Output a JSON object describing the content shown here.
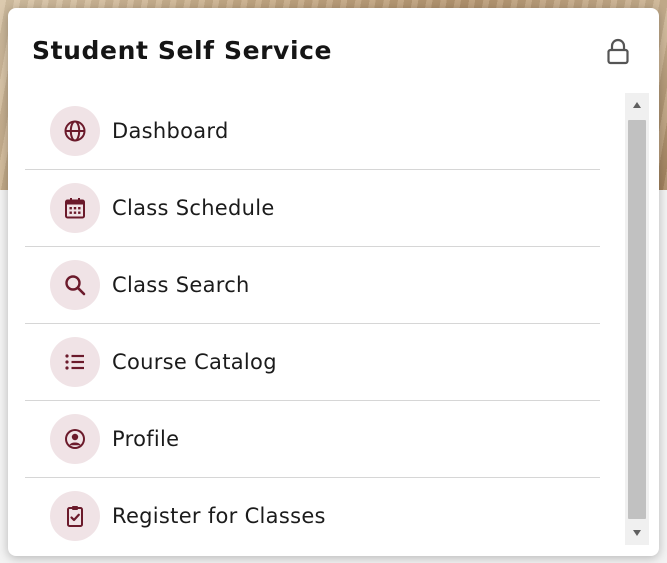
{
  "panel": {
    "title": "Student Self Service",
    "lock_icon": "lock-icon"
  },
  "menu": {
    "items": [
      {
        "label": "Dashboard",
        "icon": "globe-icon"
      },
      {
        "label": "Class Schedule",
        "icon": "calendar-icon"
      },
      {
        "label": "Class Search",
        "icon": "search-icon"
      },
      {
        "label": "Course Catalog",
        "icon": "list-icon"
      },
      {
        "label": "Profile",
        "icon": "user-circle-icon"
      },
      {
        "label": "Register for Classes",
        "icon": "clipboard-check-icon"
      }
    ]
  },
  "colors": {
    "accent": "#6b1a2b",
    "icon_bg": "#f0e3e6"
  }
}
